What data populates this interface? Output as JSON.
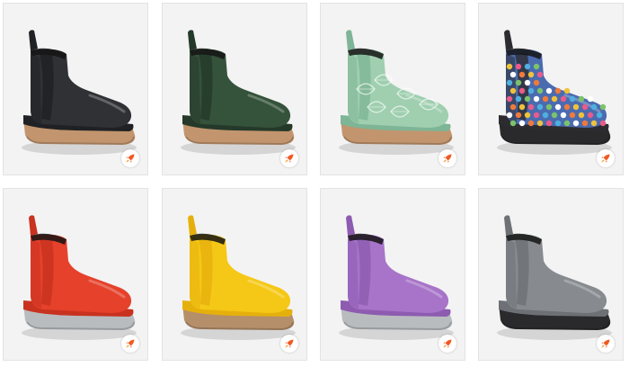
{
  "products": [
    {
      "name": "black-boot",
      "color": "#2f3134",
      "shade": "#1f2124",
      "sole": "#c2956e",
      "pattern": "none"
    },
    {
      "name": "olive-boot",
      "color": "#35523a",
      "shade": "#24392a",
      "sole": "#c2956e",
      "pattern": "none"
    },
    {
      "name": "mint-leaf-boot",
      "color": "#9fcfaf",
      "shade": "#7eb596",
      "sole": "#c2956e",
      "pattern": "leaves"
    },
    {
      "name": "floral-boot",
      "color": "#4a6bb0",
      "shade": "#2c2c30",
      "sole": "#2a2a2c",
      "pattern": "floral"
    },
    {
      "name": "red-boot",
      "color": "#e5412b",
      "shade": "#c8321f",
      "sole": "#b9bcbf",
      "pattern": "none"
    },
    {
      "name": "yellow-boot",
      "color": "#f5c817",
      "shade": "#e6b00c",
      "sole": "#b58f6a",
      "pattern": "none"
    },
    {
      "name": "purple-boot",
      "color": "#a774c9",
      "shade": "#8d5bb0",
      "sole": "#b9bcbf",
      "pattern": "none"
    },
    {
      "name": "gray-boot",
      "color": "#878b8f",
      "shade": "#6d7175",
      "sole": "#2a2a2c",
      "pattern": "none"
    }
  ],
  "badge_icon": "rocket-icon",
  "badge_color": "#f05a22"
}
